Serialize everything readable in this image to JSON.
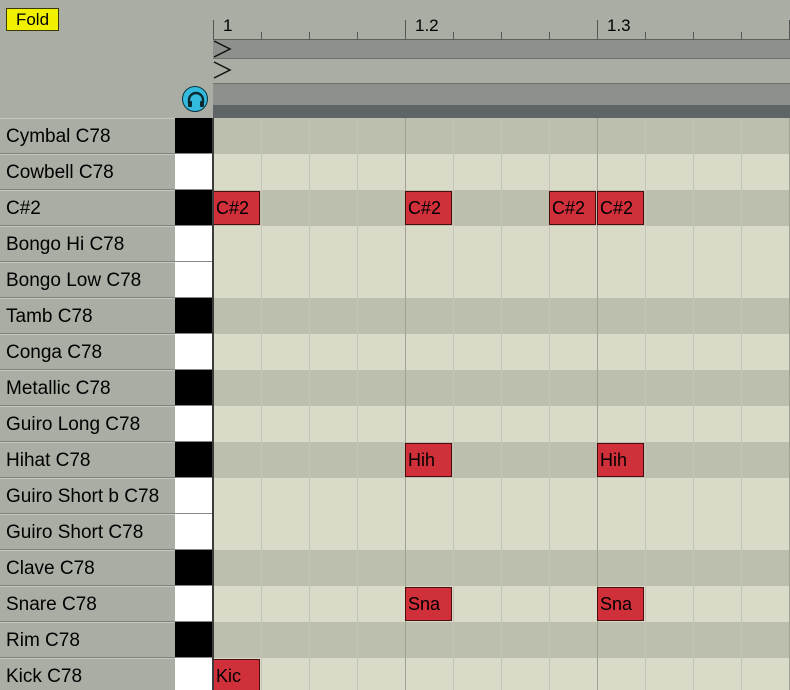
{
  "header": {
    "fold_label": "Fold",
    "headphone_icon": "headphones-icon",
    "ruler_labels": [
      "1",
      "1.2",
      "1.3"
    ]
  },
  "lanes": [
    {
      "name": "Cymbal C78",
      "key": "black"
    },
    {
      "name": "Cowbell C78",
      "key": "white"
    },
    {
      "name": "C#2",
      "key": "black"
    },
    {
      "name": "Bongo Hi C78",
      "key": "white"
    },
    {
      "name": "Bongo Low C78",
      "key": "white"
    },
    {
      "name": "Tamb C78",
      "key": "black"
    },
    {
      "name": "Conga C78",
      "key": "white"
    },
    {
      "name": "Metallic C78",
      "key": "black"
    },
    {
      "name": "Guiro Long C78",
      "key": "white"
    },
    {
      "name": "Hihat C78",
      "key": "black"
    },
    {
      "name": "Guiro Short b C78",
      "key": "white"
    },
    {
      "name": "Guiro Short C78",
      "key": "white"
    },
    {
      "name": "Clave C78",
      "key": "black"
    },
    {
      "name": "Snare C78",
      "key": "white"
    },
    {
      "name": "Rim C78",
      "key": "black"
    },
    {
      "name": "Kick C78",
      "key": "white"
    }
  ],
  "notes": [
    {
      "lane": 2,
      "step": 0,
      "label": "C#2"
    },
    {
      "lane": 2,
      "step": 4,
      "label": "C#2"
    },
    {
      "lane": 2,
      "step": 7,
      "label": "C#2"
    },
    {
      "lane": 2,
      "step": 8,
      "label": "C#2"
    },
    {
      "lane": 9,
      "step": 4,
      "label": "Hih"
    },
    {
      "lane": 9,
      "step": 8,
      "label": "Hih"
    },
    {
      "lane": 13,
      "step": 4,
      "label": "Sna"
    },
    {
      "lane": 13,
      "step": 8,
      "label": "Sna"
    },
    {
      "lane": 15,
      "step": 0,
      "label": "Kic"
    }
  ],
  "colors": {
    "note_fill": "#d0303a",
    "fold_button": "#f0f000",
    "headphone_accent": "#33bbdd"
  }
}
